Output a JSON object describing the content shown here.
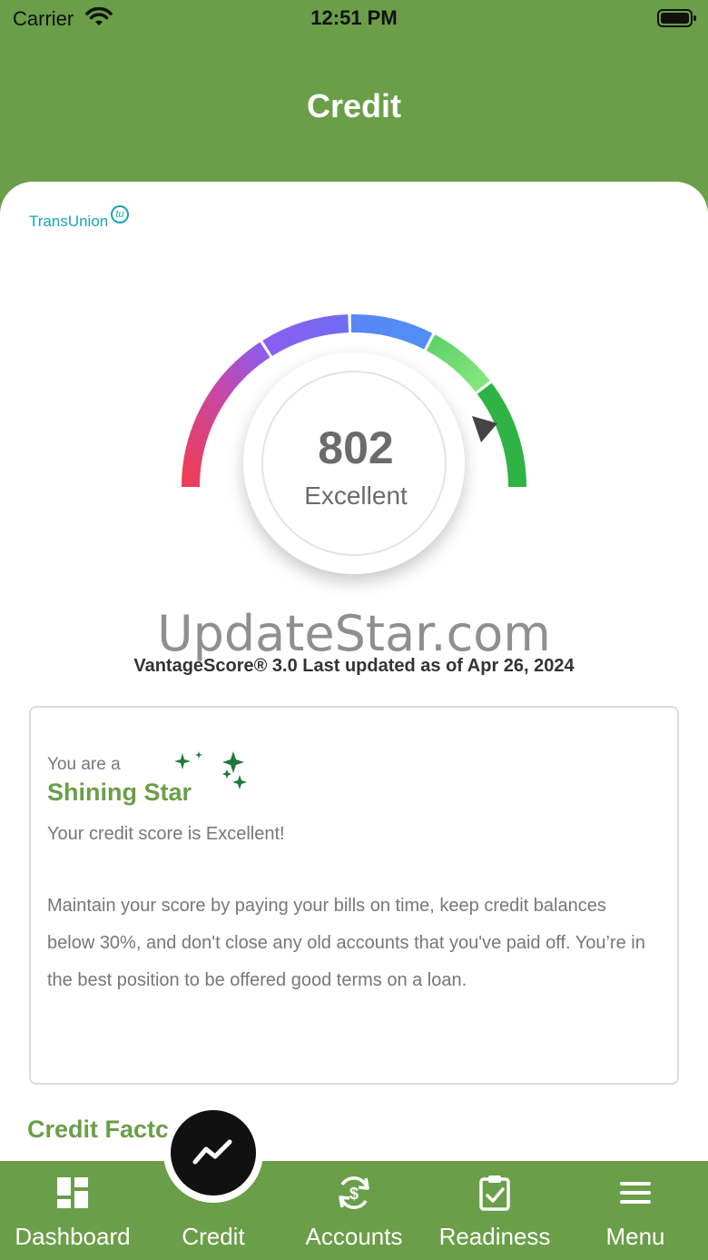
{
  "status_bar": {
    "carrier": "Carrier",
    "time": "12:51 PM"
  },
  "header": {
    "title": "Credit"
  },
  "bureau": {
    "logo_text": "TransUnion",
    "logo_mark": "tu"
  },
  "score": {
    "value": "802",
    "rating": "Excellent",
    "min": 300,
    "max": 850
  },
  "watermark": "UpdateStar.com",
  "updated_text": "VantageScore® 3.0 Last updated as of Apr 26, 2024",
  "info": {
    "intro": "You are a",
    "headline": "Shining Star",
    "status_line": "Your credit score is Excellent!",
    "advice": "Maintain your score by paying your bills on time, keep credit balances below 30%, and don't close any old accounts that you've paid off. You’re in the best position to be offered good terms on a loan."
  },
  "section": {
    "credit_factors": "Credit Factc"
  },
  "tabs": [
    {
      "label": "Dashboard",
      "icon": "dashboard-icon"
    },
    {
      "label": "Credit",
      "icon": "trend-line-icon",
      "active": true
    },
    {
      "label": "Accounts",
      "icon": "refresh-dollar-icon"
    },
    {
      "label": "Readiness",
      "icon": "clipboard-check-icon"
    },
    {
      "label": "Menu",
      "icon": "hamburger-menu-icon"
    }
  ],
  "colors": {
    "brand_green": "#6a9e48",
    "gauge_red": "#ef3d55",
    "gauge_purple": "#8b5cf0",
    "gauge_blue": "#4f8ff5",
    "gauge_light_green": "#7fe07a",
    "gauge_green": "#2fb344",
    "transunion_teal": "#1aa3b5"
  }
}
